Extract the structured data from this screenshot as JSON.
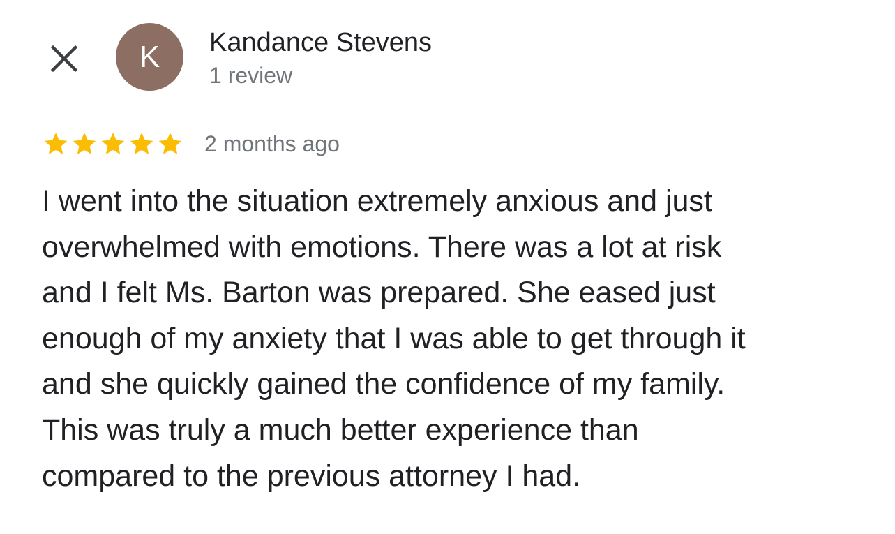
{
  "header": {
    "close_icon": "close-icon",
    "avatar_initial": "K",
    "avatar_color": "#8d6e63",
    "author_name": "Kandance Stevens",
    "author_meta": "1 review"
  },
  "rating": {
    "stars": 5,
    "max_stars": 5,
    "star_color": "#fbbc04",
    "star_icon": "star-icon",
    "time_ago": "2 months ago"
  },
  "review": {
    "lines": [
      "I went into the situation extremely anxious and just",
      "overwhelmed with emotions. There was a lot at risk",
      "and I felt Ms. Barton was prepared. She eased just",
      "enough of my anxiety that I was able to get through it",
      "and she quickly gained the confidence of my family.",
      "This was truly a much better experience than",
      "compared to the previous attorney I had."
    ]
  }
}
